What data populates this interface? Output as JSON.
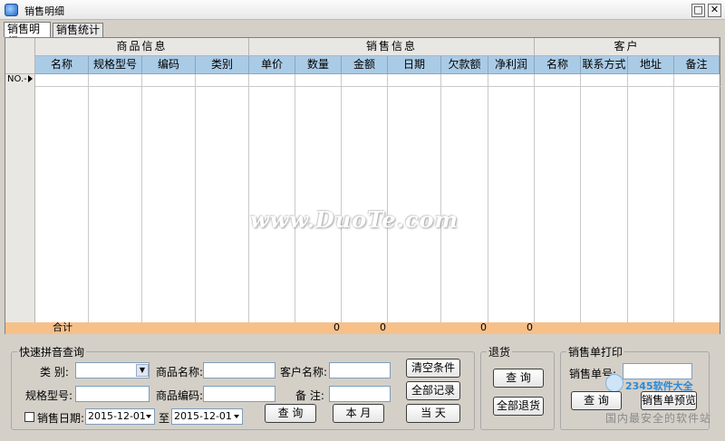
{
  "window": {
    "title": "销售明细",
    "max_glyph": "□",
    "close_glyph": "✕"
  },
  "tabs": [
    "销售明细",
    "销售统计"
  ],
  "grid": {
    "groups": [
      "商品信息",
      "销售信息",
      "客户"
    ],
    "columns": [
      "名称",
      "规格型号",
      "编码",
      "类别",
      "单价",
      "数量",
      "金额",
      "日期",
      "欠款额",
      "净利润",
      "名称",
      "联系方式",
      "地址",
      "备注"
    ],
    "row_label": "NO.-",
    "total_label": "合计",
    "totals": {
      "quantity": "0",
      "amount": "0",
      "debt": "0",
      "profit": "0"
    },
    "header_bg": "#aacbe6",
    "total_bg": "#f7c089"
  },
  "watermark": "www.DuoTe.com",
  "query": {
    "legend": "快速拼音查询",
    "category_label": "类 别:",
    "product_name_label": "商品名称:",
    "customer_name_label": "客户名称:",
    "spec_label": "规格型号:",
    "product_code_label": "商品编码:",
    "remark_label": "备 注:",
    "sale_date_label": "销售日期:",
    "date_from": "2015-12-01",
    "date_to_label": "至",
    "date_to": "2015-12-01",
    "clear_button": "清空条件",
    "all_records_button": "全部记录",
    "today_button": "当 天",
    "query_button": "查 询",
    "this_month_button": "本 月"
  },
  "returns": {
    "legend": "退货",
    "query_button": "查 询",
    "all_returns_button": "全部退货"
  },
  "print": {
    "legend": "销售单打印",
    "order_no_label": "销售单号:",
    "query_button": "查 询",
    "preview_button": "销售单预览"
  },
  "brand": {
    "name": "2345软件大全",
    "sub": "国内最安全的软件站"
  }
}
